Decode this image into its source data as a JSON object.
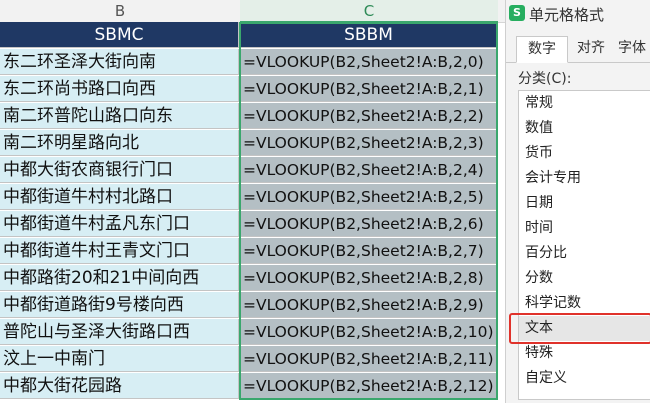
{
  "sheet": {
    "column_b": "B",
    "column_c": "C",
    "header": {
      "b": "SBMC",
      "c": "SBBM"
    },
    "rows": [
      {
        "b": "东二环圣泽大街向南",
        "c": "=VLOOKUP(B2,Sheet2!A:B,2,0)"
      },
      {
        "b": "东二环尚书路口向西",
        "c": "=VLOOKUP(B2,Sheet2!A:B,2,1)"
      },
      {
        "b": "南二环普陀山路口向东",
        "c": "=VLOOKUP(B2,Sheet2!A:B,2,2)"
      },
      {
        "b": "南二环明星路向北",
        "c": "=VLOOKUP(B2,Sheet2!A:B,2,3)"
      },
      {
        "b": "中都大街农商银行门口",
        "c": "=VLOOKUP(B2,Sheet2!A:B,2,4)"
      },
      {
        "b": "中都街道牛村村北路口",
        "c": "=VLOOKUP(B2,Sheet2!A:B,2,5)"
      },
      {
        "b": "中都街道牛村孟凡东门口",
        "c": "=VLOOKUP(B2,Sheet2!A:B,2,6)"
      },
      {
        "b": "中都街道牛村王青文门口",
        "c": "=VLOOKUP(B2,Sheet2!A:B,2,7)"
      },
      {
        "b": "中都路街20和21中间向西",
        "c": "=VLOOKUP(B2,Sheet2!A:B,2,8)"
      },
      {
        "b": "中都街道路街9号楼向西",
        "c": "=VLOOKUP(B2,Sheet2!A:B,2,9)"
      },
      {
        "b": "普陀山与圣泽大街路口西",
        "c": "=VLOOKUP(B2,Sheet2!A:B,2,10)"
      },
      {
        "b": "汶上一中南门",
        "c": "=VLOOKUP(B2,Sheet2!A:B,2,11)"
      },
      {
        "b": "中都大街花园路",
        "c": "=VLOOKUP(B2,Sheet2!A:B,2,12)"
      }
    ]
  },
  "dialog": {
    "icon": "S",
    "title": "单元格格式",
    "tabs": [
      "数字",
      "对齐",
      "字体"
    ],
    "category_label": "分类(C):",
    "categories": [
      "常规",
      "数值",
      "货币",
      "会计专用",
      "日期",
      "时间",
      "百分比",
      "分数",
      "科学记数",
      "文本",
      "特殊",
      "自定义"
    ],
    "selected_category": "文本",
    "highlight_color": "#e0322b"
  }
}
